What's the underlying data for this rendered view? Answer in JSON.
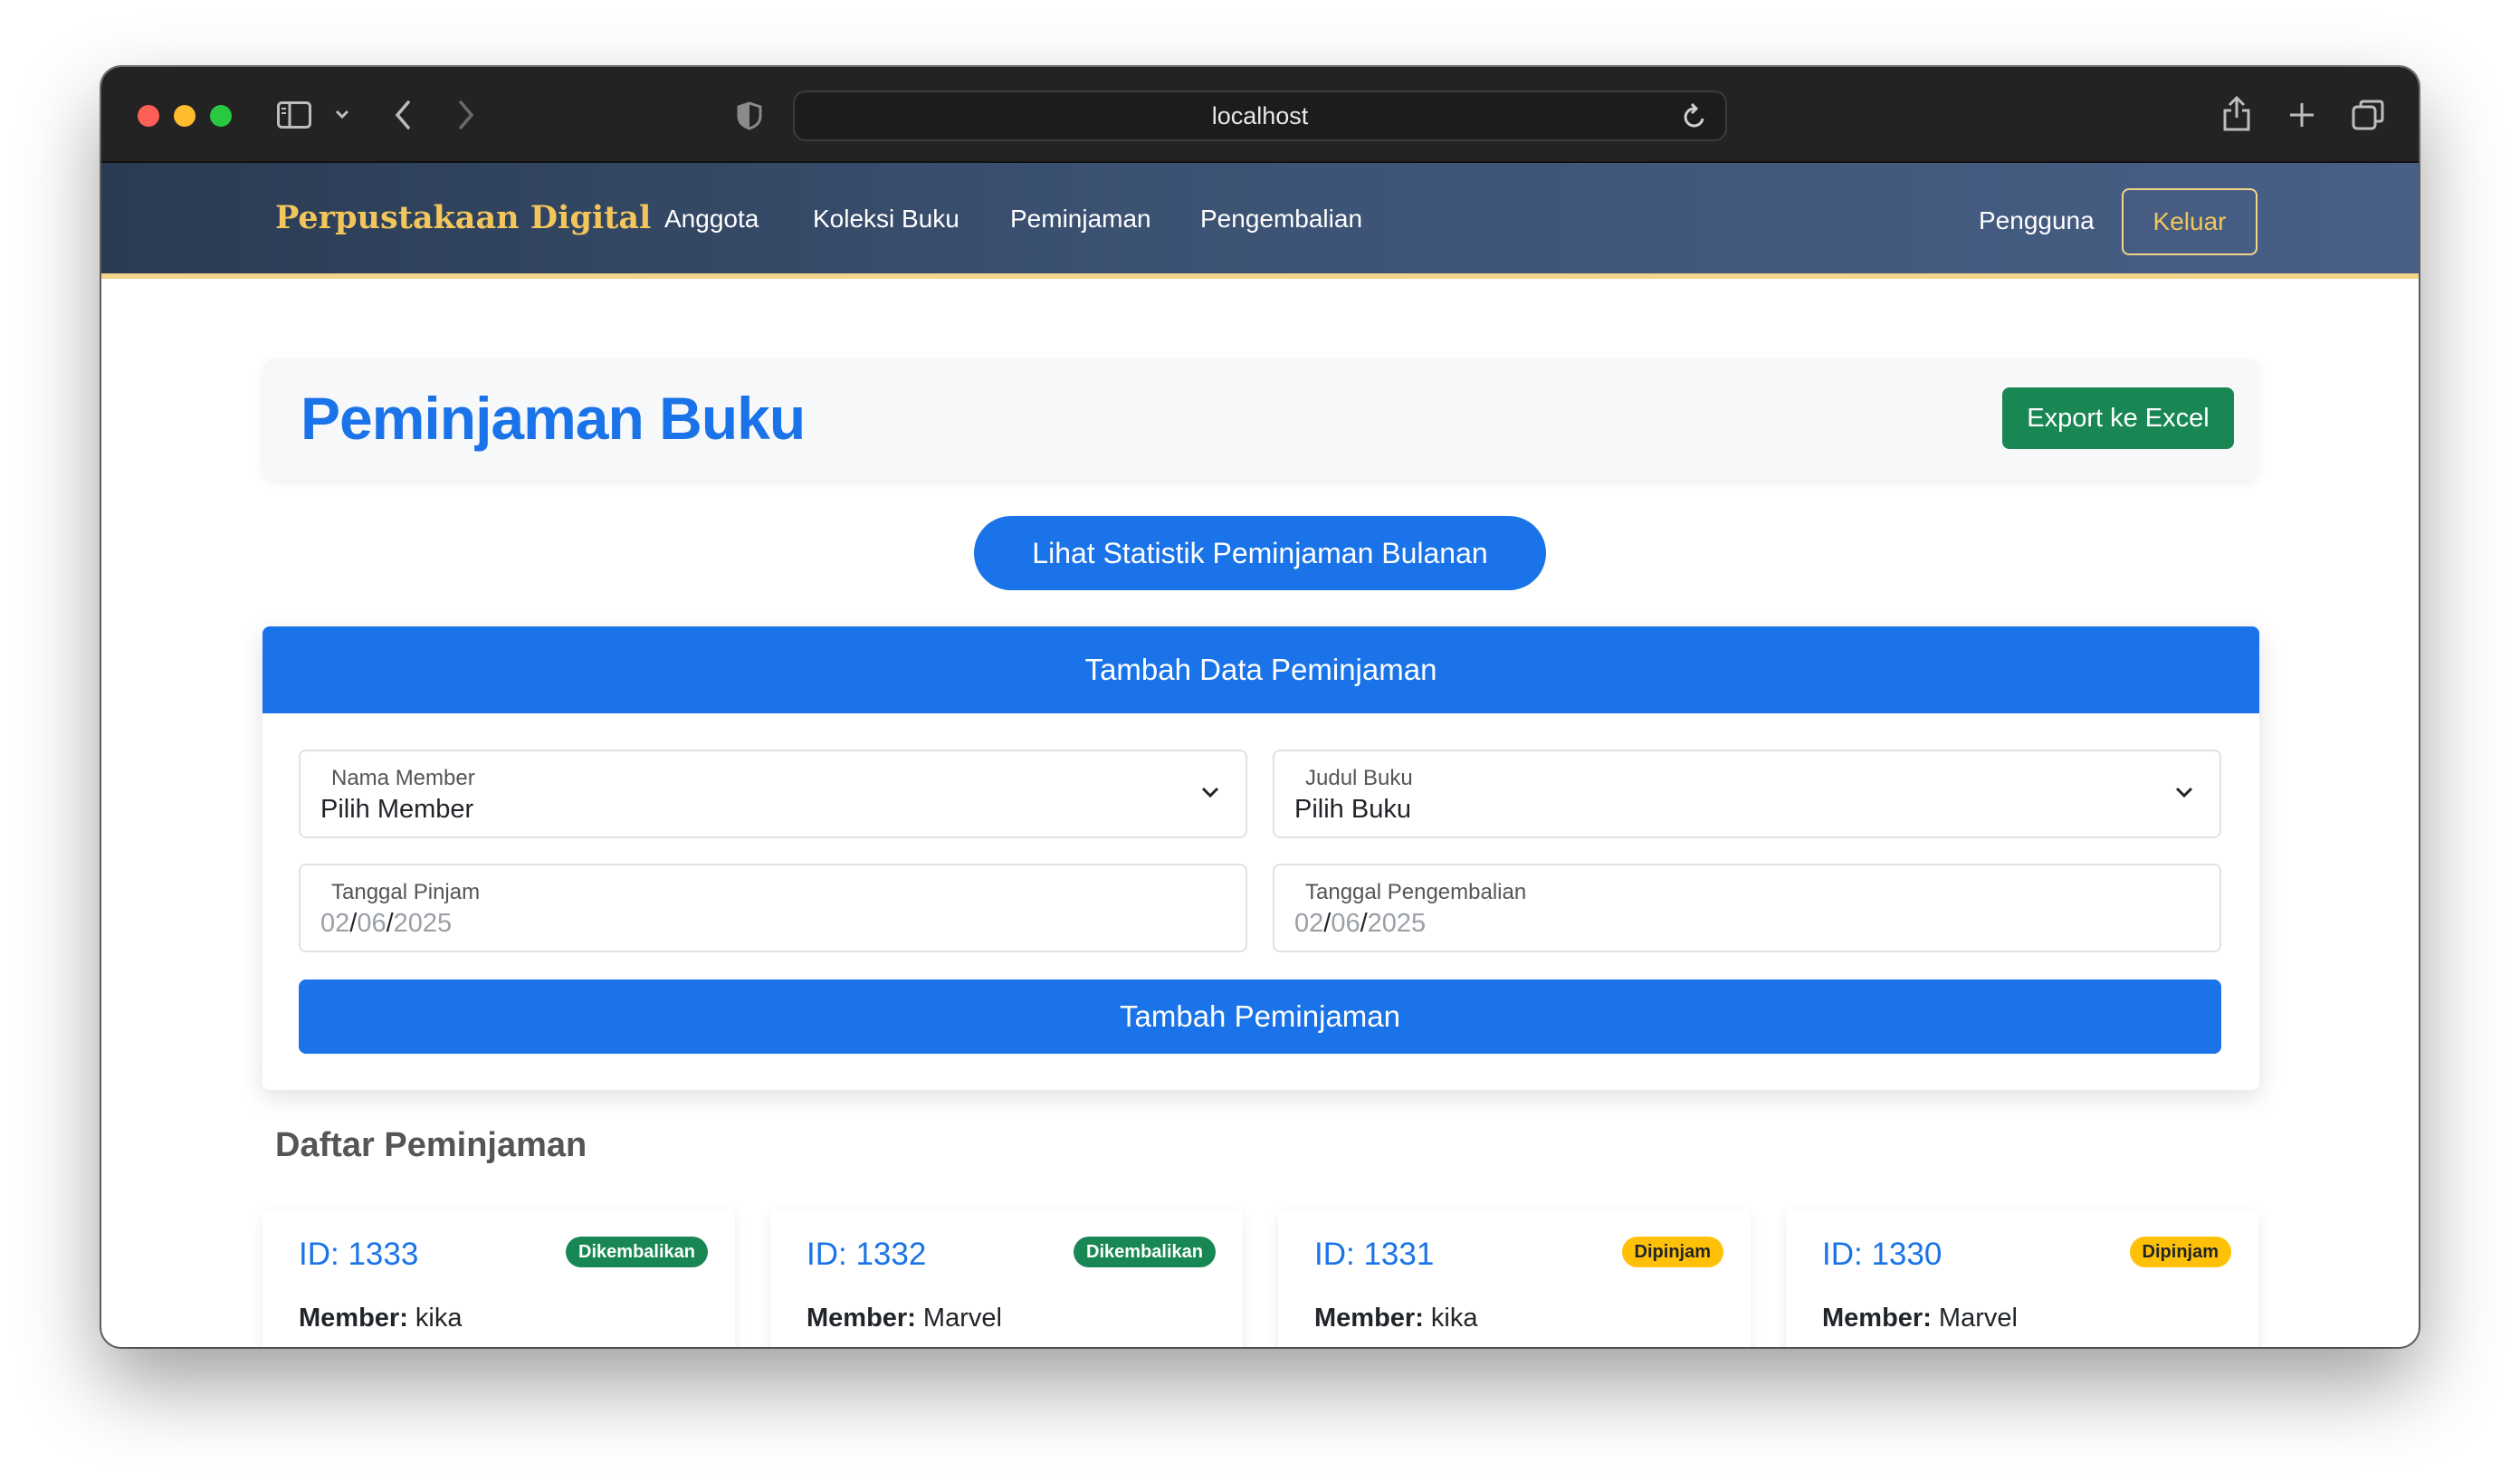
{
  "browser": {
    "url": "localhost"
  },
  "navbar": {
    "brand": "Perpustakaan Digital",
    "links": [
      "Anggota",
      "Koleksi Buku",
      "Peminjaman",
      "Pengembalian"
    ],
    "user_label": "Pengguna",
    "logout_label": "Keluar"
  },
  "header": {
    "title": "Peminjaman Buku",
    "export_label": "Export ke Excel"
  },
  "stats_button": "Lihat Statistik Peminjaman Bulanan",
  "form": {
    "title": "Tambah Data Peminjaman",
    "member": {
      "label": "Nama Member",
      "value": "Pilih Member"
    },
    "book": {
      "label": "Judul Buku",
      "value": "Pilih Buku"
    },
    "loan_date": {
      "label": "Tanggal Pinjam",
      "day": "02",
      "month": "06",
      "year": "2025"
    },
    "return_date": {
      "label": "Tanggal Pengembalian",
      "day": "02",
      "month": "06",
      "year": "2025"
    },
    "submit_label": "Tambah Peminjaman"
  },
  "list": {
    "title": "Daftar Peminjaman",
    "member_prefix": "Member:",
    "loans": [
      {
        "id": "ID: 1333",
        "status": "Dikembalikan",
        "member": "kika"
      },
      {
        "id": "ID: 1332",
        "status": "Dikembalikan",
        "member": "Marvel"
      },
      {
        "id": "ID: 1331",
        "status": "Dipinjam",
        "member": "kika"
      },
      {
        "id": "ID: 1330",
        "status": "Dipinjam",
        "member": "Marvel"
      }
    ]
  },
  "colors": {
    "primary": "#1a73e8",
    "success": "#198754",
    "warning": "#ffc107",
    "brand_gold": "#f2c65a"
  }
}
